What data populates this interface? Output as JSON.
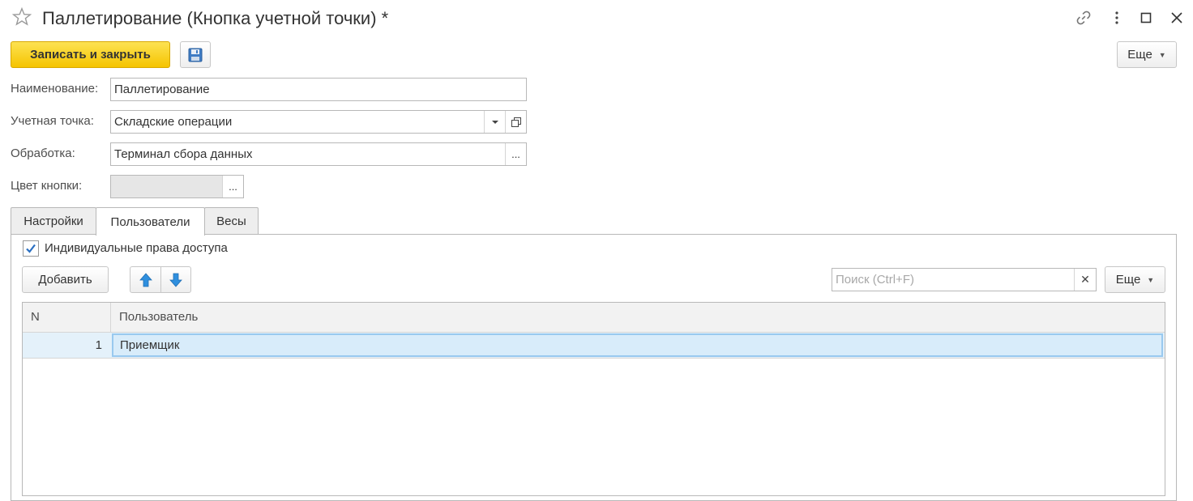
{
  "window": {
    "title": "Паллетирование (Кнопка учетной точки) *",
    "icons": [
      "star-icon",
      "link-icon",
      "more-vertical-icon",
      "maximize-icon",
      "close-icon"
    ]
  },
  "toolbar": {
    "save_close_label": "Записать и закрыть",
    "more_label": "Еще"
  },
  "form": {
    "name_label": "Наименование:",
    "name_value": "Паллетирование",
    "point_label": "Учетная точка:",
    "point_value": "Складские операции",
    "processing_label": "Обработка:",
    "processing_value": "Терминал сбора данных",
    "color_label": "Цвет кнопки:",
    "select_btn": "..."
  },
  "tabs": [
    {
      "label": "Настройки",
      "active": false
    },
    {
      "label": "Пользователи",
      "active": true
    },
    {
      "label": "Весы",
      "active": false
    }
  ],
  "users_tab": {
    "individual_access_label": "Индивидуальные права доступа",
    "individual_access_checked": true,
    "add_label": "Добавить",
    "search_placeholder": "Поиск (Ctrl+F)",
    "more_label": "Еще",
    "columns": [
      "N",
      "Пользователь"
    ],
    "rows": [
      {
        "n": "1",
        "user": "Приемщик"
      }
    ]
  },
  "colors": {
    "accent": "#f5c400",
    "selection": "#d8ecfa",
    "arrow_blue": "#2f8fde"
  }
}
